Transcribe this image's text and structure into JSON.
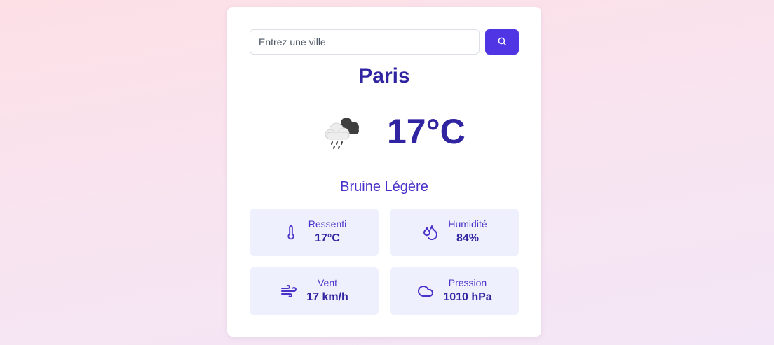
{
  "search": {
    "placeholder": "Entrez une ville"
  },
  "city": "Paris",
  "weather": {
    "icon": "drizzle-cloud-icon",
    "temperature": "17°C",
    "description": "Bruine Légère"
  },
  "stats": [
    {
      "icon": "thermometer-icon",
      "label": "Ressenti",
      "value": "17°C"
    },
    {
      "icon": "droplets-icon",
      "label": "Humidité",
      "value": "84%"
    },
    {
      "icon": "wind-icon",
      "label": "Vent",
      "value": "17 km/h"
    },
    {
      "icon": "cloud-icon",
      "label": "Pression",
      "value": "1010 hPa"
    }
  ],
  "colors": {
    "accent": "#4f35e3",
    "text_dark": "#3124a0",
    "tile_bg": "#eef1fd"
  }
}
